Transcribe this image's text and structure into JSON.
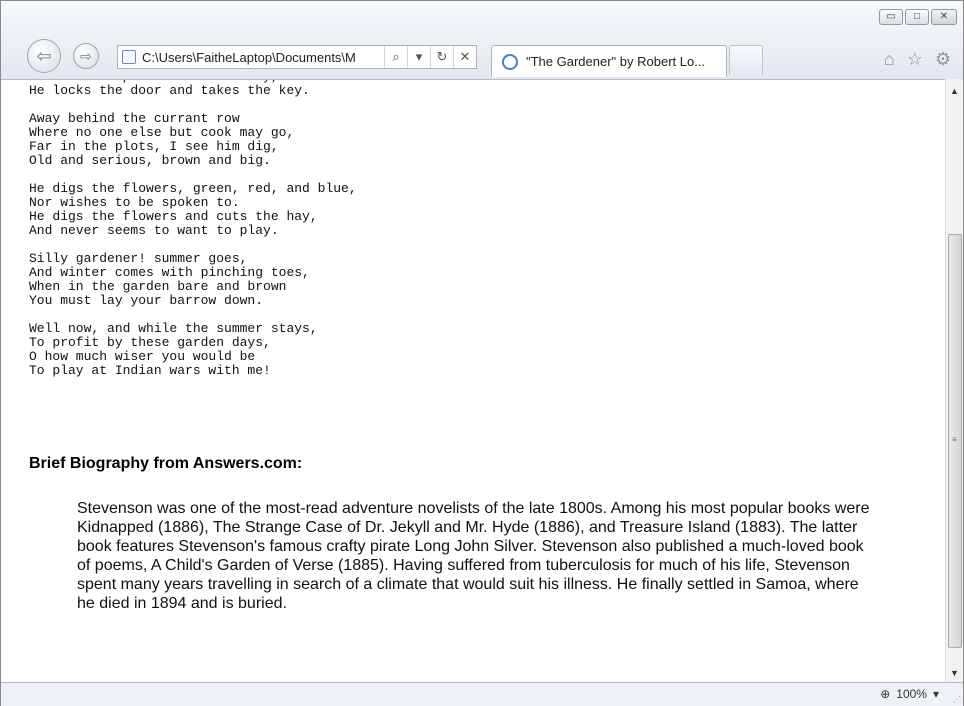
{
  "browser": {
    "address": "C:\\Users\\FaitheLaptop\\Documents\\M",
    "tab_title": "\"The Gardener\" by Robert Lo...",
    "search_glyph": "⌕",
    "dropdown_glyph": "▾",
    "refresh_glyph": "↻",
    "stop_glyph": "✕",
    "back_glyph": "⇦",
    "forward_glyph": "⇨",
    "home_glyph": "⌂",
    "favorites_glyph": "☆",
    "tools_glyph": "⚙",
    "minimize_glyph": "▭",
    "maximize_glyph": "□",
    "close_glyph": "✕"
  },
  "poem": {
    "stanzas": [
      "And when he puts his tools away,\nHe locks the door and takes the key.",
      "Away behind the currant row\nWhere no one else but cook may go,\nFar in the plots, I see him dig,\nOld and serious, brown and big.",
      "He digs the flowers, green, red, and blue,\nNor wishes to be spoken to.\nHe digs the flowers and cuts the hay,\nAnd never seems to want to play.",
      "Silly gardener! summer goes,\nAnd winter comes with pinching toes,\nWhen in the garden bare and brown\nYou must lay your barrow down.",
      "Well now, and while the summer stays,\nTo profit by these garden days,\nO how much wiser you would be\nTo play at Indian wars with me!"
    ]
  },
  "bio": {
    "heading": "Brief Biography from Answers.com:",
    "text": "Stevenson was one of the most-read adventure novelists of the late 1800s. Among his most popular books were Kidnapped (1886), The Strange Case of Dr. Jekyll and Mr. Hyde (1886), and Treasure Island (1883). The latter book features Stevenson's famous crafty pirate Long John Silver. Stevenson also published a much-loved book of poems, A Child's Garden of Verse (1885). Having suffered from tuberculosis for much of his life, Stevenson spent many years travelling in search of a climate that would suit his illness. He finally settled in Samoa, where he died in 1894 and is buried."
  },
  "statusbar": {
    "zoom_glyph": "⊕",
    "zoom": "100%",
    "zoom_dropdown": "▾"
  }
}
